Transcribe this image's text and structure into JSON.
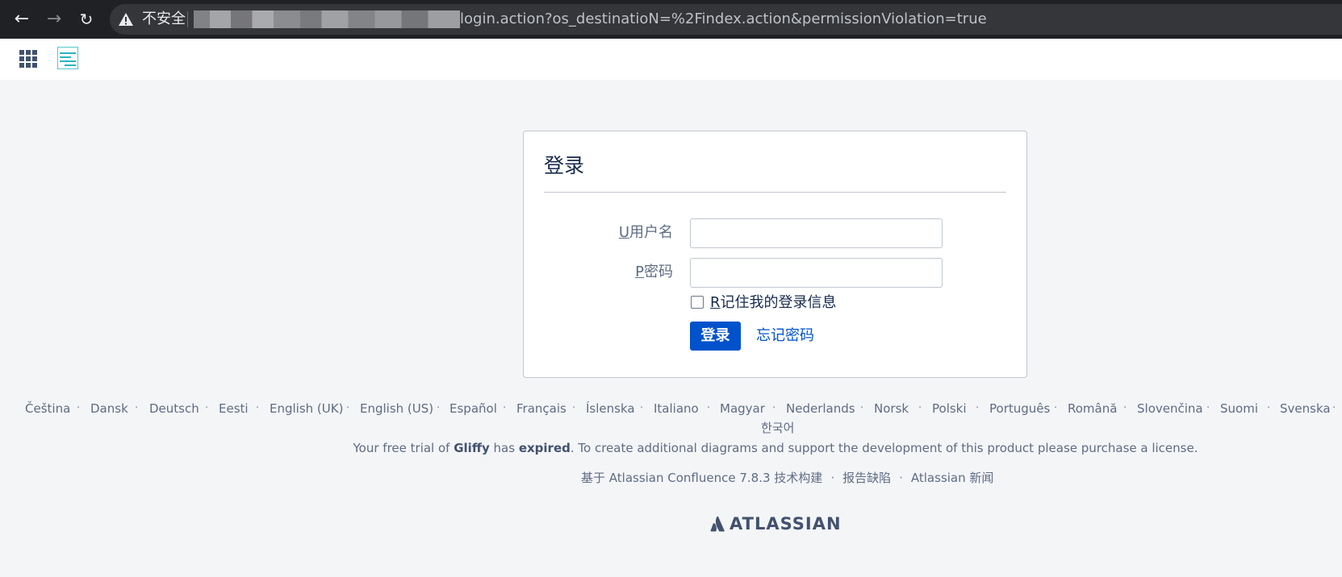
{
  "browser": {
    "back_icon": "arrow-left-icon",
    "forward_icon": "arrow-right-icon",
    "reload_icon": "reload-icon",
    "security_label": "不安全",
    "url": "login.action?os_destinatioN=%2Findex.action&permissionViolation=true"
  },
  "header": {
    "app_switcher_icon": "app-grid-icon",
    "logo_icon": "site-logo-icon"
  },
  "login": {
    "title": "登录",
    "username_label_key": "U",
    "username_label": "用户名",
    "password_label_key": "P",
    "password_label": "密码",
    "username_value": "",
    "password_value": "",
    "remember_key": "R",
    "remember_label": "记住我的登录信息",
    "remember_checked": false,
    "submit_label": "登录",
    "forgot_label": "忘记密码",
    "primary_color": "#0052cc"
  },
  "footer": {
    "languages": [
      "Čeština",
      "Dansk",
      "Deutsch",
      "Eesti",
      "English (UK)",
      "English (US)",
      "Español",
      "Français",
      "Íslenska",
      "Italiano",
      "Magyar",
      "Nederlands",
      "Norsk",
      "Polski",
      "Português",
      "Română",
      "Slovenčina",
      "Suomi",
      "Svenska",
      "한국어"
    ],
    "separator": "·",
    "trial_prefix": "Your free trial of ",
    "trial_product": "Gliffy",
    "trial_mid": " has ",
    "trial_status": "expired",
    "trial_suffix": ". To create additional diagrams and support the development of this product please purchase a license.",
    "powered_by": "基于 Atlassian Confluence 7.8.3 技术构建",
    "report_bug": "报告缺陷",
    "news": "Atlassian 新闻",
    "brand": "ATLASSIAN"
  }
}
